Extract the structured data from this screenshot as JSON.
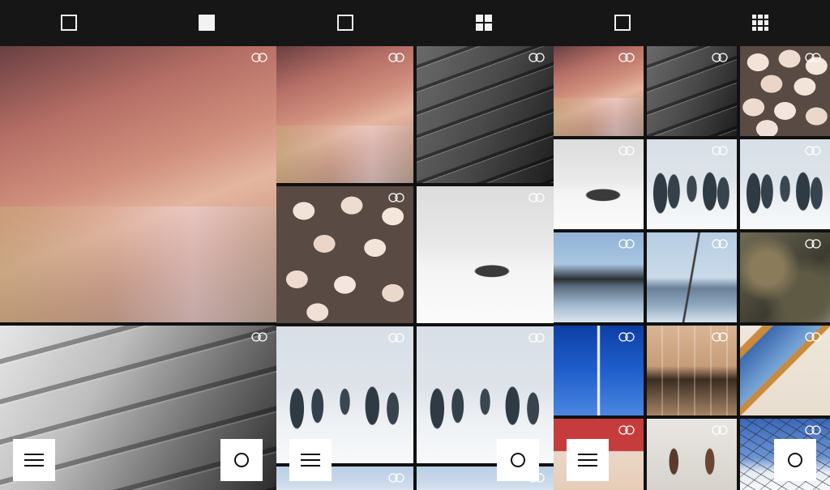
{
  "topbar": {
    "icons": [
      {
        "name": "single-outline-layout-icon"
      },
      {
        "name": "single-filled-layout-icon"
      },
      {
        "name": "single-outline-layout-icon"
      },
      {
        "name": "four-grid-layout-icon"
      },
      {
        "name": "single-outline-layout-icon"
      },
      {
        "name": "nine-grid-layout-icon"
      }
    ]
  },
  "overlay_icon": "linked-rings-icon",
  "fab": {
    "menu_icon": "hamburger-menu-icon",
    "capture_icon": "circle-capture-icon"
  },
  "colors": {
    "bar": "#161616",
    "icon": "#f2f2f2",
    "fab_bg": "#ffffff"
  }
}
